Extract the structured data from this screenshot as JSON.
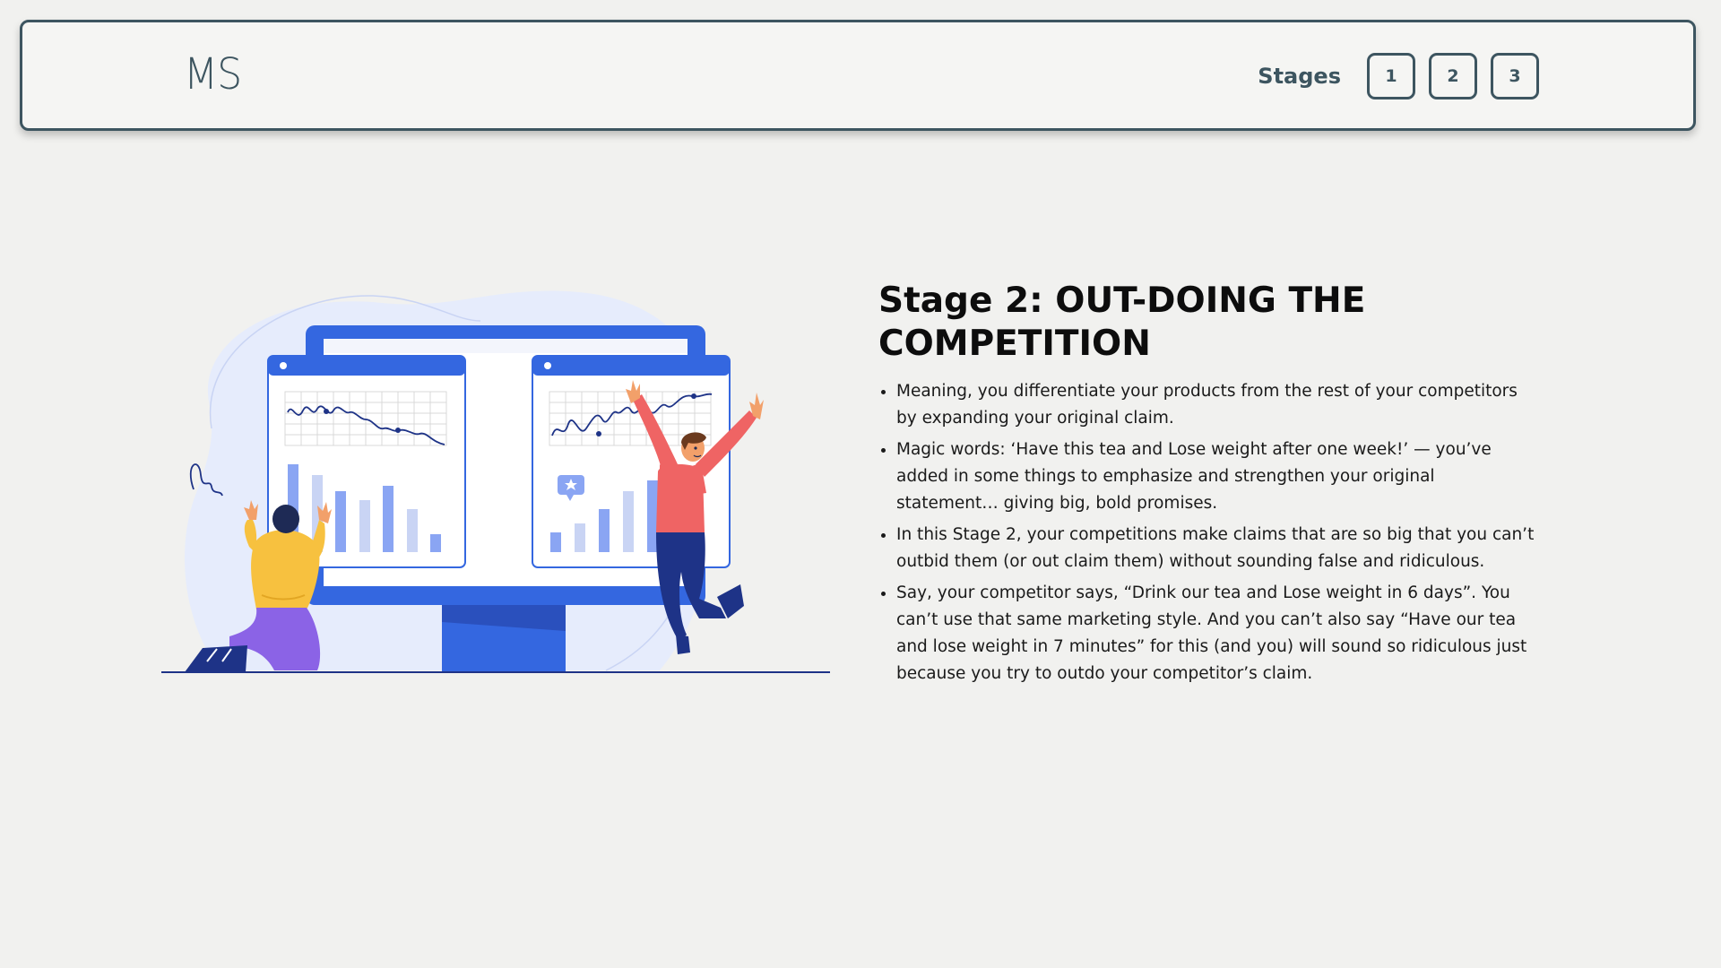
{
  "header": {
    "logo": "MS",
    "stages_label": "Stages",
    "stage_buttons": [
      "1",
      "2",
      "3"
    ]
  },
  "main": {
    "title": "Stage 2: OUT-DOING THE COMPETITION",
    "bullets": [
      "Meaning, you differentiate your products from the rest of your competitors by expanding your original claim.",
      "Magic words: ‘Have this tea and Lose weight after one week!’ — you’ve added in some things to emphasize and strengthen your original statement… giving big, bold promises.",
      "In this Stage 2, your competitions make claims that are so big that you can’t outbid them (or out claim them) without sounding false and ridiculous.",
      "Say, your competitor says, “Drink our tea and Lose weight in 6 days”. You can’t use that same marketing style. And you can’t also say “Have our tea and lose weight in 7 minutes” for this (and you) will sound so ridiculous just because you try to outdo your competitor’s claim."
    ]
  },
  "colors": {
    "header_border": "#3d5560",
    "monitor_blue": "#3467e0",
    "light_blue": "#e6ecfc",
    "bar_blue": "#8aa5f3",
    "yellow": "#f7c13f",
    "red": "#ef6464",
    "navy": "#1e3387"
  }
}
